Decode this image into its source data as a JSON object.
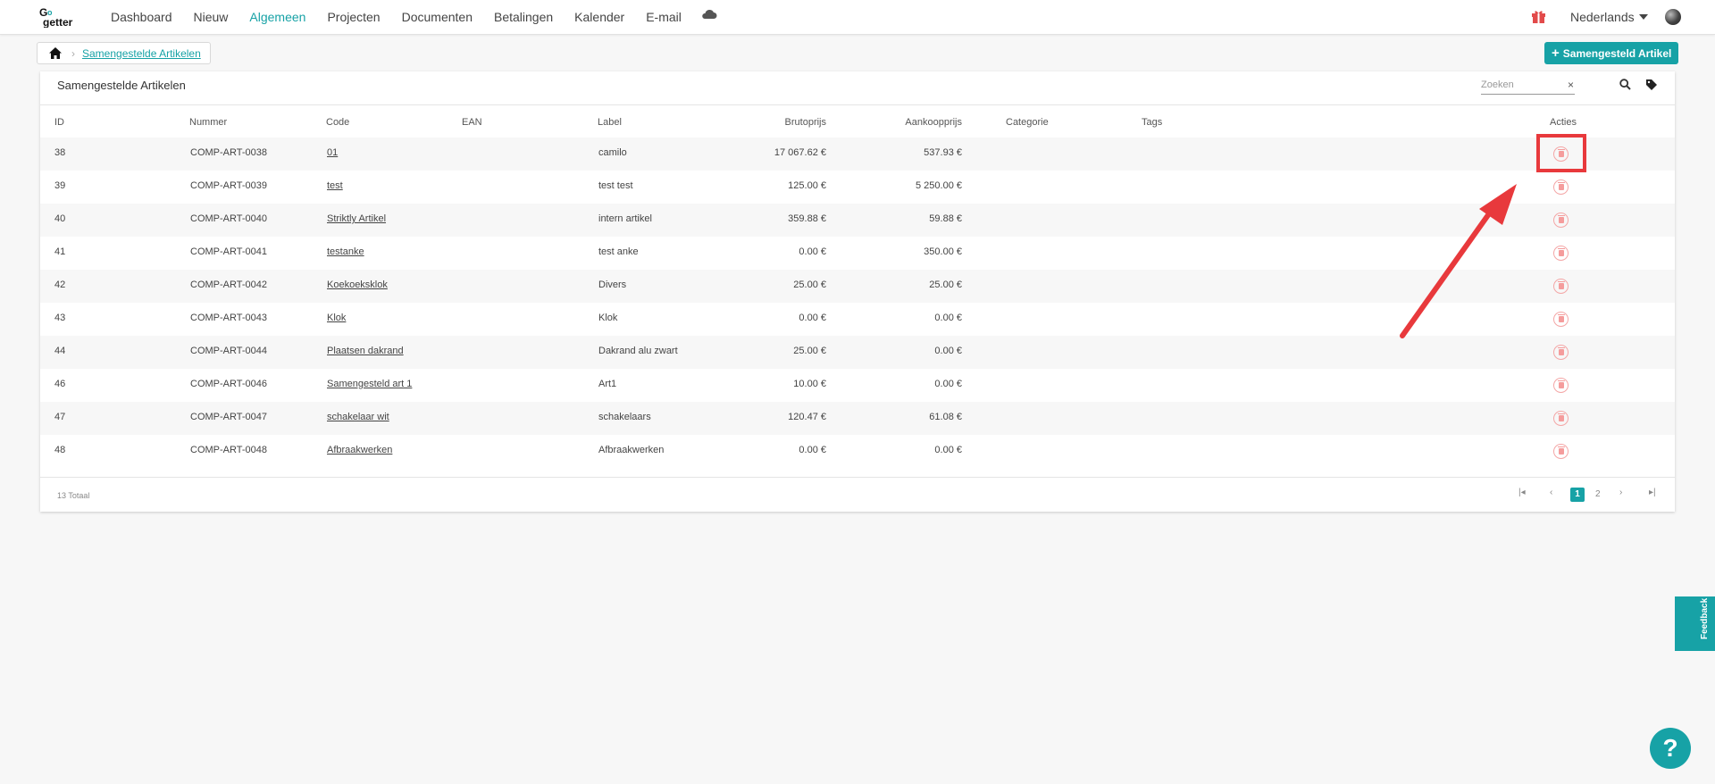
{
  "nav": {
    "logo_text": "Go getter",
    "items": [
      "Dashboard",
      "Nieuw",
      "Algemeen",
      "Projecten",
      "Documenten",
      "Betalingen",
      "Kalender",
      "E-mail"
    ],
    "active": "Algemeen",
    "language": "Nederlands"
  },
  "breadcrumb": {
    "current": "Samengestelde Artikelen"
  },
  "add_button": "Samengesteld Artikel",
  "card": {
    "title": "Samengestelde Artikelen",
    "search_placeholder": "Zoeken",
    "clear": "×"
  },
  "table": {
    "headers": {
      "id": "ID",
      "nummer": "Nummer",
      "code": "Code",
      "ean": "EAN",
      "label": "Label",
      "brutoprijs": "Brutoprijs",
      "aankoopprijs": "Aankoopprijs",
      "categorie": "Categorie",
      "tags": "Tags",
      "acties": "Acties"
    },
    "rows": [
      {
        "id": "38",
        "nummer": "COMP-ART-0038",
        "code": "01",
        "label": "camilo",
        "bruto": "17 067.62 €",
        "aankoop": "537.93 €"
      },
      {
        "id": "39",
        "nummer": "COMP-ART-0039",
        "code": "test",
        "label": "test test",
        "bruto": "125.00 €",
        "aankoop": "5 250.00 €"
      },
      {
        "id": "40",
        "nummer": "COMP-ART-0040",
        "code": "Striktly Artikel",
        "label": "intern artikel",
        "bruto": "359.88 €",
        "aankoop": "59.88 €"
      },
      {
        "id": "41",
        "nummer": "COMP-ART-0041",
        "code": "testanke",
        "label": "test anke",
        "bruto": "0.00 €",
        "aankoop": "350.00 €"
      },
      {
        "id": "42",
        "nummer": "COMP-ART-0042",
        "code": "Koekoeksklok",
        "label": "Divers",
        "bruto": "25.00 €",
        "aankoop": "25.00 €"
      },
      {
        "id": "43",
        "nummer": "COMP-ART-0043",
        "code": "Klok",
        "label": "Klok",
        "bruto": "0.00 €",
        "aankoop": "0.00 €"
      },
      {
        "id": "44",
        "nummer": "COMP-ART-0044",
        "code": "Plaatsen dakrand",
        "label": "Dakrand alu zwart",
        "bruto": "25.00 €",
        "aankoop": "0.00 €"
      },
      {
        "id": "46",
        "nummer": "COMP-ART-0046",
        "code": "Samengesteld art 1",
        "label": "Art1",
        "bruto": "10.00 €",
        "aankoop": "0.00 €"
      },
      {
        "id": "47",
        "nummer": "COMP-ART-0047",
        "code": "schakelaar wit",
        "label": "schakelaars",
        "bruto": "120.47 €",
        "aankoop": "61.08 €"
      },
      {
        "id": "48",
        "nummer": "COMP-ART-0048",
        "code": "Afbraakwerken",
        "label": "Afbraakwerken",
        "bruto": "0.00 €",
        "aankoop": "0.00 €"
      }
    ]
  },
  "footer": {
    "total": "13 Totaal",
    "pages": [
      "1",
      "2"
    ],
    "current_page": "1"
  },
  "feedback": "Feedback",
  "help": "?",
  "colors": {
    "accent": "#17a2a6",
    "annotation": "#e8393c",
    "delete": "#f59c9c"
  }
}
